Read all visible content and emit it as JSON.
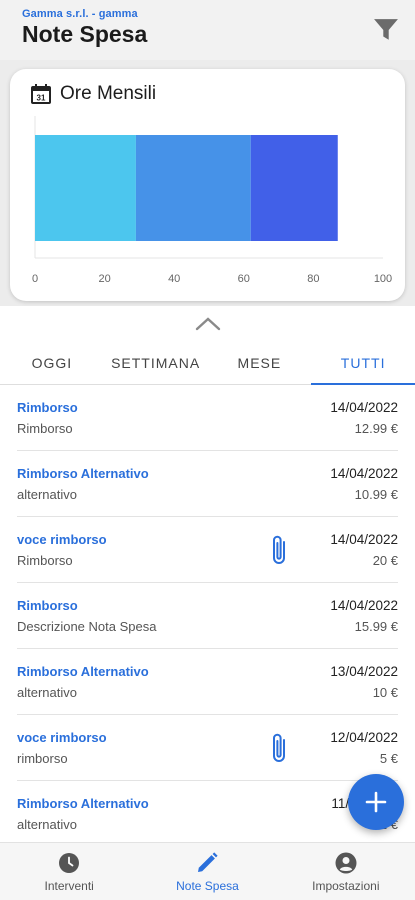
{
  "header": {
    "company": "Gamma s.r.l. - gamma",
    "title": "Note Spesa",
    "filter_icon": "filter-icon"
  },
  "chart_card": {
    "title": "Ore Mensili",
    "icon": "calendar-icon"
  },
  "chart_data": {
    "type": "bar",
    "orientation": "horizontal-stacked",
    "categories": [
      ""
    ],
    "series": [
      {
        "values": [
          29
        ],
        "color": "#4cc6ee"
      },
      {
        "values": [
          33
        ],
        "color": "#4692e8"
      },
      {
        "values": [
          25
        ],
        "color": "#4160e8"
      }
    ],
    "xlim": [
      0,
      100
    ],
    "xticks": [
      "0",
      "20",
      "40",
      "60",
      "80",
      "100"
    ],
    "title": "",
    "xlabel": "",
    "ylabel": ""
  },
  "tabs": [
    {
      "label": "OGGI",
      "active": false
    },
    {
      "label": "SETTIMANA",
      "active": false
    },
    {
      "label": "MESE",
      "active": false
    },
    {
      "label": "TUTTI",
      "active": true
    }
  ],
  "expenses": [
    {
      "name": "Rimborso",
      "desc": "Rimborso",
      "date": "14/04/2022",
      "amount": "12.99 €",
      "attachment": false
    },
    {
      "name": "Rimborso Alternativo",
      "desc": "alternativo",
      "date": "14/04/2022",
      "amount": "10.99 €",
      "attachment": false
    },
    {
      "name": "voce rimborso",
      "desc": "Rimborso",
      "date": "14/04/2022",
      "amount": "20 €",
      "attachment": true
    },
    {
      "name": "Rimborso",
      "desc": "Descrizione Nota Spesa",
      "date": "14/04/2022",
      "amount": "15.99 €",
      "attachment": false
    },
    {
      "name": "Rimborso Alternativo",
      "desc": "alternativo",
      "date": "13/04/2022",
      "amount": "10 €",
      "attachment": false
    },
    {
      "name": "voce rimborso",
      "desc": "rimborso",
      "date": "12/04/2022",
      "amount": "5 €",
      "attachment": true
    },
    {
      "name": "Rimborso Alternativo",
      "desc": "alternativo",
      "date": "11/04/2022",
      "amount": "12 €",
      "attachment": false
    }
  ],
  "fab": {
    "icon": "plus-icon"
  },
  "bottom_nav": [
    {
      "label": "Interventi",
      "icon": "clock-icon",
      "active": false
    },
    {
      "label": "Note Spesa",
      "icon": "pencil-icon",
      "active": true
    },
    {
      "label": "Impostazioni",
      "icon": "account-icon",
      "active": false
    }
  ],
  "colors": {
    "accent": "#2a6fdb"
  }
}
